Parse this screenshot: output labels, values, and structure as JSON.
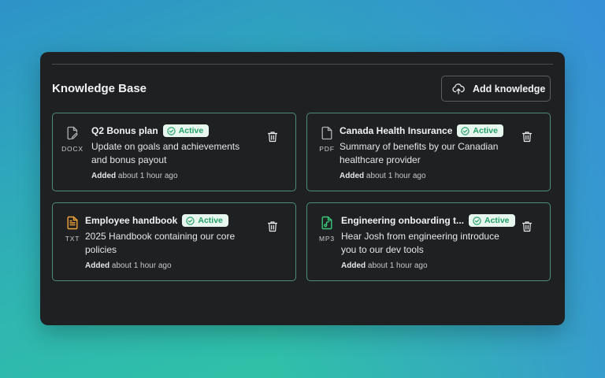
{
  "knowledge_base": {
    "title": "Knowledge Base",
    "add_label": "Add knowledge",
    "cards": [
      {
        "name": "Q2 Bonus plan",
        "status": "Active",
        "file_ext": "DOCX",
        "file_icon": "doc-edit-icon",
        "icon_color": "#aeb1b4",
        "desc_line1": "Update on goals and achievements",
        "desc_line2": "and bonus payout",
        "added_label": "Added",
        "added_time": "about 1 hour ago"
      },
      {
        "name": "Canada Health Insurance",
        "status": "Active",
        "file_ext": "PDF",
        "file_icon": "file-icon",
        "icon_color": "#aeb1b4",
        "desc_line1": "Summary of benefits by our Canadian",
        "desc_line2": "healthcare provider",
        "added_label": "Added",
        "added_time": "about 1 hour ago"
      },
      {
        "name": "Employee handbook",
        "status": "Active",
        "file_ext": "TXT",
        "file_icon": "file-text-icon",
        "icon_color": "#f0a43a",
        "desc_line1": "2025 Handbook containing our core",
        "desc_line2": "policies",
        "added_label": "Added",
        "added_time": "about 1 hour ago"
      },
      {
        "name": "Engineering onboarding t...",
        "status": "Active",
        "file_ext": "MP3",
        "file_icon": "file-audio-icon",
        "icon_color": "#38c77a",
        "desc_line1": "Hear Josh from engineering introduce",
        "desc_line2": "you to our dev tools",
        "added_label": "Added",
        "added_time": "about 1 hour ago"
      }
    ]
  },
  "colors": {
    "panel_bg": "#1f2021",
    "card_border": "#4e8c7c",
    "badge_bg": "#e7f6ee",
    "badge_text": "#23a067"
  }
}
